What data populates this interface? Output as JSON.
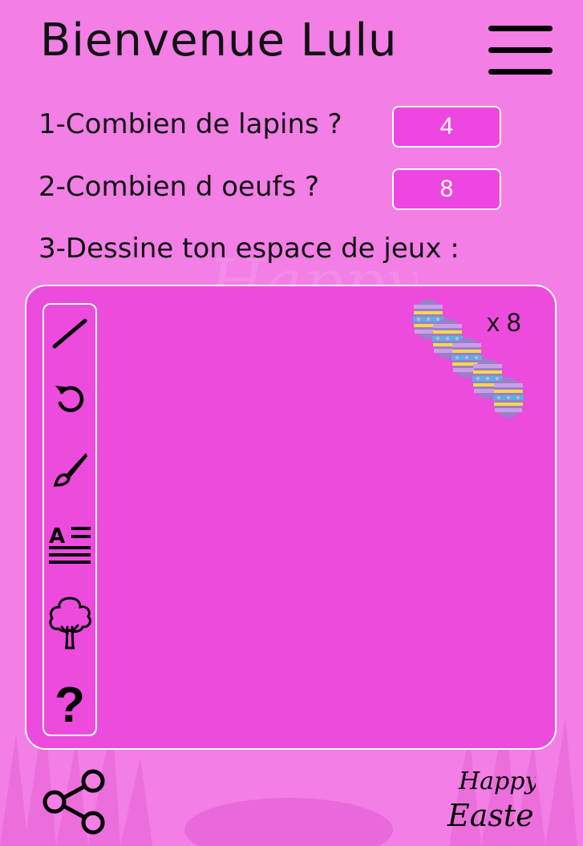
{
  "header": {
    "title": "Bienvenue Lulu"
  },
  "questions": [
    {
      "label": "1-Combien de lapins ?",
      "answer": "4"
    },
    {
      "label": "2-Combien d oeufs ?",
      "answer": "8"
    },
    {
      "label": "3-Dessine ton espace de jeux :"
    }
  ],
  "canvas": {
    "egg_count_label": "x 8"
  },
  "toolbar": {
    "tools": [
      "line-tool",
      "undo",
      "brush",
      "text",
      "tree",
      "help"
    ],
    "help_glyph": "?"
  },
  "footer": {
    "logo_line1": "Happy",
    "logo_line2": "Easter"
  },
  "colors": {
    "background": "#f27ee6",
    "canvas": "#ed4bdd",
    "border": "#ffffff",
    "answer_bg": "#ee46e0"
  }
}
